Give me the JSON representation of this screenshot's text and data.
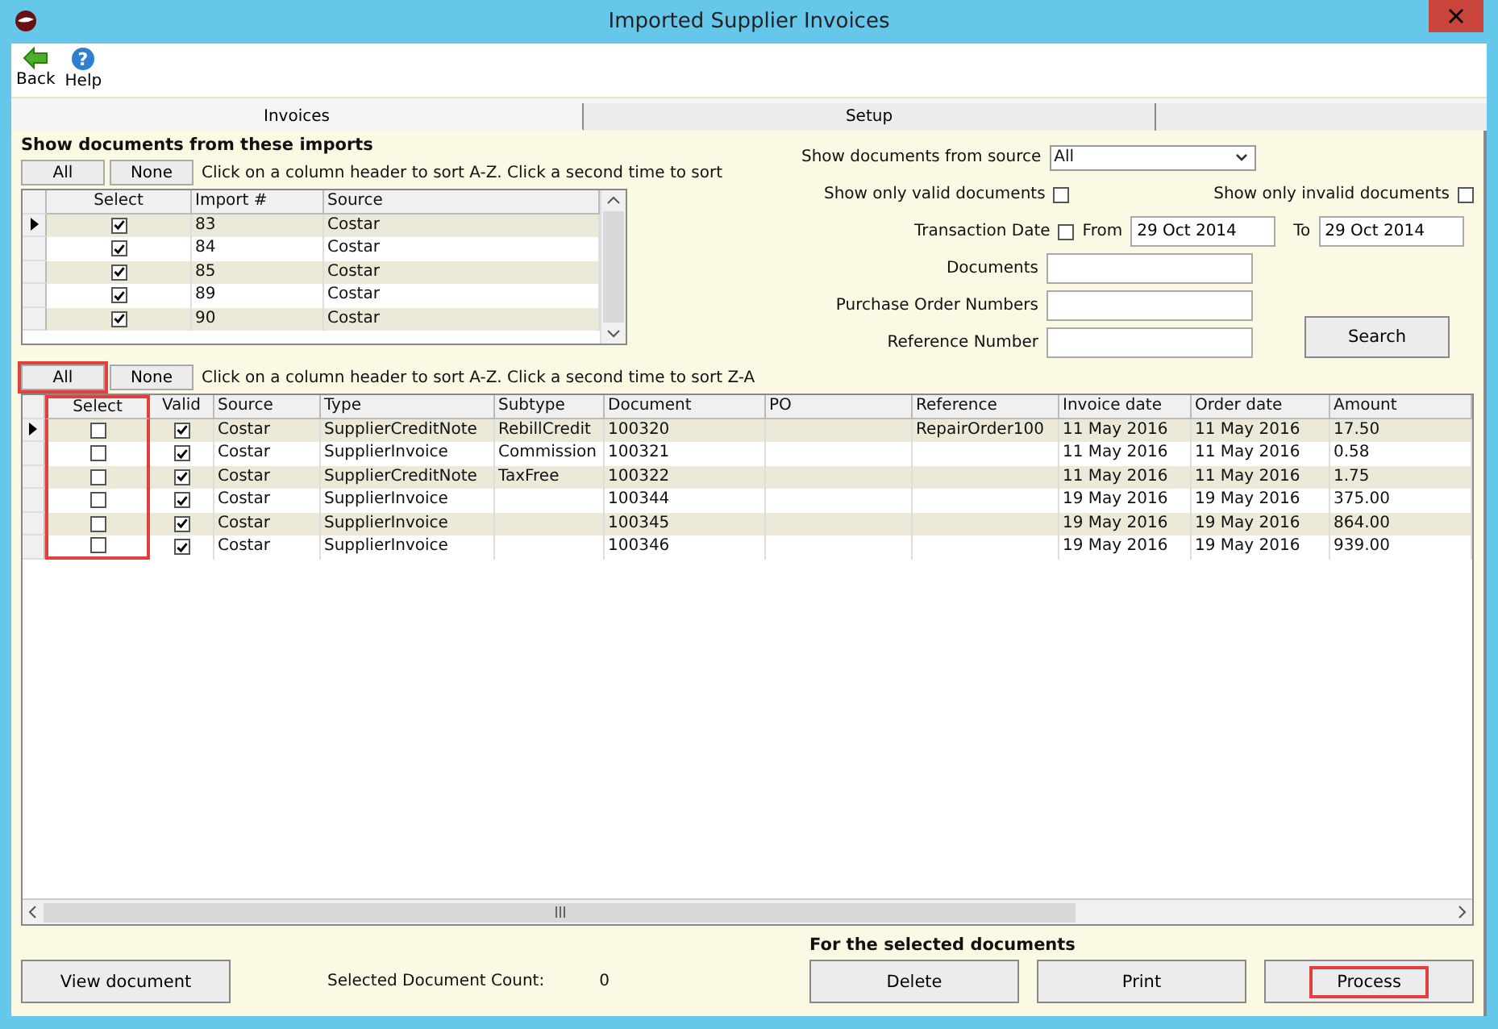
{
  "window": {
    "title": "Imported Supplier Invoices"
  },
  "toolbar": [
    {
      "label": "Back",
      "kind": "back"
    },
    {
      "label": "Help",
      "kind": "help",
      "glyph": "?"
    }
  ],
  "tabs": [
    {
      "label": "Invoices",
      "selected": true
    },
    {
      "label": "Setup",
      "selected": false
    }
  ],
  "imports": {
    "heading": "Show documents from these imports",
    "buttons": [
      {
        "label": "All",
        "highlighted": false
      },
      {
        "label": "None",
        "highlighted": false
      }
    ],
    "hint": "Click on a column header to sort A-Z.  Click a second time to sort",
    "checkbox_column": "Select",
    "columns": [
      "Import #",
      "Source"
    ],
    "rows": [
      {
        "current": true,
        "selected": true,
        "cells": [
          "83",
          "Costar"
        ]
      },
      {
        "current": false,
        "selected": true,
        "cells": [
          "84",
          "Costar"
        ]
      },
      {
        "current": false,
        "selected": true,
        "cells": [
          "85",
          "Costar"
        ]
      },
      {
        "current": false,
        "selected": true,
        "cells": [
          "89",
          "Costar"
        ]
      },
      {
        "current": false,
        "selected": true,
        "cells": [
          "90",
          "Costar"
        ]
      }
    ]
  },
  "filters": {
    "source": {
      "label": "Show documents from source",
      "value": "All"
    },
    "valid_only": {
      "label": "Show only valid documents",
      "checked": false
    },
    "invalid_only": {
      "label": "Show only invalid documents",
      "checked": false
    },
    "transaction_date": {
      "label": "Transaction Date",
      "checked": false,
      "from_label": "From",
      "from": "29 Oct 2014",
      "to_label": "To",
      "to": "29 Oct 2014"
    },
    "text_fields": [
      {
        "label": "Documents"
      },
      {
        "label": "Purchase Order Numbers"
      },
      {
        "label": "Reference Number"
      }
    ],
    "search": "Search"
  },
  "documents": {
    "buttons": [
      {
        "label": "All",
        "highlighted": true
      },
      {
        "label": "None",
        "highlighted": false
      }
    ],
    "hint": "Click on a column header to sort A-Z.  Click a second time to sort Z-A",
    "checkbox_columns": [
      {
        "label": "Select",
        "highlighted": true
      },
      {
        "label": "Valid",
        "highlighted": false
      }
    ],
    "columns": [
      "Source",
      "Type",
      "Subtype",
      "Document",
      "PO",
      "Reference",
      "Invoice date",
      "Order date",
      "Amount"
    ],
    "rows": [
      {
        "current": true,
        "selected": false,
        "valid": true,
        "cells": [
          "Costar",
          "SupplierCreditNote",
          "RebillCredit",
          "100320",
          "",
          "RepairOrder100",
          "11 May 2016",
          "11 May 2016",
          "17.50"
        ]
      },
      {
        "current": false,
        "selected": false,
        "valid": true,
        "cells": [
          "Costar",
          "SupplierInvoice",
          "Commission",
          "100321",
          "",
          "",
          "11 May 2016",
          "11 May 2016",
          "0.58"
        ]
      },
      {
        "current": false,
        "selected": false,
        "valid": true,
        "cells": [
          "Costar",
          "SupplierCreditNote",
          "TaxFree",
          "100322",
          "",
          "",
          "11 May 2016",
          "11 May 2016",
          "1.75"
        ]
      },
      {
        "current": false,
        "selected": false,
        "valid": true,
        "cells": [
          "Costar",
          "SupplierInvoice",
          "",
          "100344",
          "",
          "",
          "19 May 2016",
          "19 May 2016",
          "375.00"
        ]
      },
      {
        "current": false,
        "selected": false,
        "valid": true,
        "cells": [
          "Costar",
          "SupplierInvoice",
          "",
          "100345",
          "",
          "",
          "19 May 2016",
          "19 May 2016",
          "864.00"
        ]
      },
      {
        "current": false,
        "selected": false,
        "valid": true,
        "cells": [
          "Costar",
          "SupplierInvoice",
          "",
          "100346",
          "",
          "",
          "19 May 2016",
          "19 May 2016",
          "939.00"
        ]
      }
    ]
  },
  "footer": {
    "view_button": {
      "label": "View document",
      "highlighted": false
    },
    "count_label": "Selected Document Count:",
    "count": "0",
    "actions_heading": "For the selected documents",
    "actions": [
      {
        "label": "Delete",
        "highlighted": false
      },
      {
        "label": "Print",
        "highlighted": false
      },
      {
        "label": "Process",
        "highlighted": true
      }
    ]
  }
}
